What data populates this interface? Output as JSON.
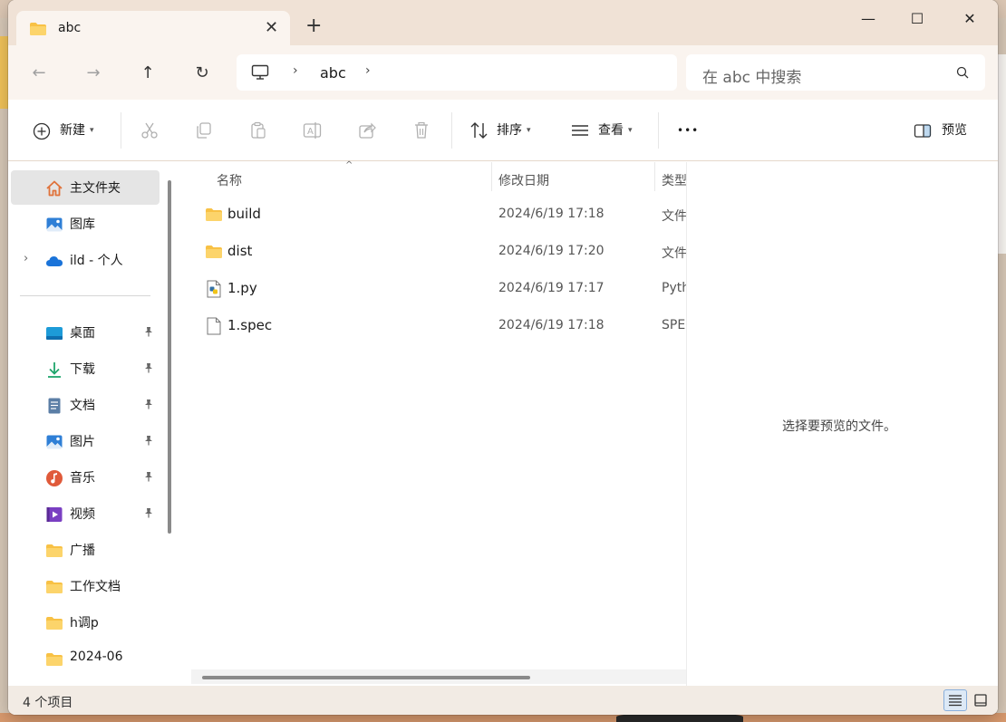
{
  "window": {
    "tab_title": "abc",
    "tab_close": "✕",
    "new_tab": "+",
    "controls": {
      "minimize": "—",
      "maximize": "☐",
      "close": "✕"
    }
  },
  "nav": {
    "back": "←",
    "forward": "→",
    "up": "↑",
    "refresh": "↻",
    "breadcrumb": [
      "abc"
    ],
    "search_placeholder": "在 abc 中搜索"
  },
  "toolbar": {
    "new_label": "新建",
    "sort_label": "排序",
    "view_label": "查看",
    "more_label": "•••",
    "preview_label": "预览"
  },
  "sidebar": {
    "top_items": [
      {
        "label": "主文件夹",
        "icon": "home-icon",
        "selected": true
      },
      {
        "label": "图库",
        "icon": "gallery-icon"
      },
      {
        "label": "ild - 个人",
        "icon": "cloud-icon",
        "expandable": true
      }
    ],
    "quick_access": [
      {
        "label": "桌面",
        "icon": "desktop-icon",
        "pinned": true
      },
      {
        "label": "下载",
        "icon": "download-icon",
        "pinned": true
      },
      {
        "label": "文档",
        "icon": "document-icon",
        "pinned": true
      },
      {
        "label": "图片",
        "icon": "pictures-icon",
        "pinned": true
      },
      {
        "label": "音乐",
        "icon": "music-icon",
        "pinned": true
      },
      {
        "label": "视频",
        "icon": "video-icon",
        "pinned": true
      },
      {
        "label": "广播",
        "icon": "folder-icon"
      },
      {
        "label": "工作文档",
        "icon": "folder-icon"
      },
      {
        "label": "h调p",
        "icon": "folder-icon"
      },
      {
        "label": "2024-06",
        "icon": "folder-icon"
      }
    ]
  },
  "filelist": {
    "columns": {
      "name": "名称",
      "date": "修改日期",
      "type": "类型"
    },
    "rows": [
      {
        "name": "build",
        "date": "2024/6/19 17:18",
        "type": "文件夹",
        "icon": "folder-icon"
      },
      {
        "name": "dist",
        "date": "2024/6/19 17:20",
        "type": "文件夹",
        "icon": "folder-icon"
      },
      {
        "name": "1.py",
        "date": "2024/6/19 17:17",
        "type": "Python",
        "icon": "python-file-icon"
      },
      {
        "name": "1.spec",
        "date": "2024/6/19 17:18",
        "type": "SPEC",
        "icon": "file-icon"
      }
    ]
  },
  "preview": {
    "message": "选择要预览的文件。"
  },
  "status": {
    "item_count": "4 个项目"
  },
  "colors": {
    "title_bar": "#f0e2d6",
    "nav_bar": "#faf4ef",
    "folder": "#f8c145",
    "accent": "#0067c0"
  }
}
